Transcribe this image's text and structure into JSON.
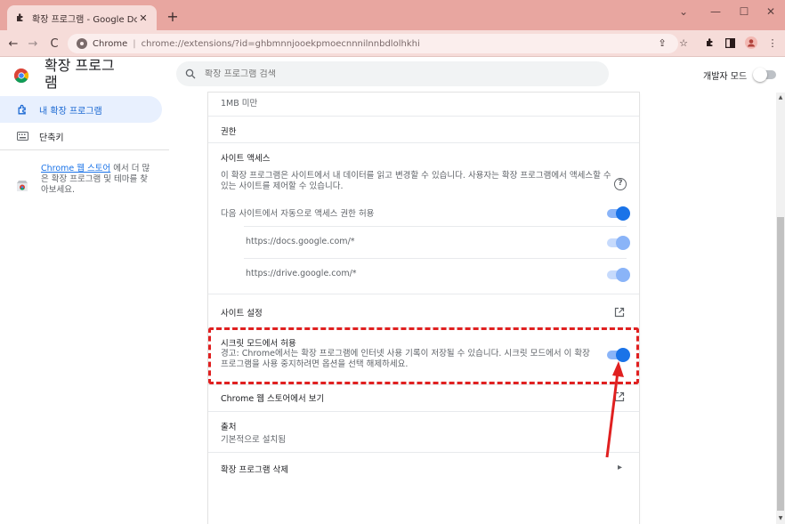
{
  "browser": {
    "tab_title": "확장 프로그램 - Google Docs 오",
    "new_tab_label": "+",
    "omnibox_site": "Chrome",
    "omnibox_url": "chrome://extensions/?id=ghbmnnjooekpmoecnnnilnnbdlolhkhi"
  },
  "header": {
    "title": "확장 프로그램",
    "search_placeholder": "확장 프로그램 검색",
    "dev_mode_label": "개발자 모드"
  },
  "sidebar": {
    "items": [
      {
        "label": "내 확장 프로그램",
        "icon": "puzzle-icon",
        "active": true
      },
      {
        "label": "단축키",
        "icon": "keyboard-icon",
        "active": false
      }
    ],
    "promo_link": "Chrome 웹 스토어",
    "promo_text": "에서 더 많은 확장 프로그램 및 테마를 찾아보세요."
  },
  "details": {
    "size": "1MB 미만",
    "permissions": "권한",
    "site_access_title": "사이트 액세스",
    "site_access_desc": "이 확장 프로그램은 사이트에서 내 데이터를 읽고 변경할 수 있습니다. 사용자는 확장 프로그램에서 액세스할 수 있는 사이트를 제어할 수 있습니다.",
    "auto_access_label": "다음 사이트에서 자동으로 액세스 권한 허용",
    "sites": [
      "https://docs.google.com/*",
      "https://drive.google.com/*"
    ],
    "site_settings": "사이트 설정",
    "incognito_title": "시크릿 모드에서 허용",
    "incognito_warning": "경고: Chrome에서는 확장 프로그램에 인터넷 사용 기록이 저장될 수 있습니다. 시크릿 모드에서 이 확장 프로그램을 사용 중지하려면 옵션을 선택 해제하세요.",
    "webstore_view": "Chrome 웹 스토어에서 보기",
    "source_title": "출처",
    "source_value": "기본적으로 설치됨",
    "remove_label": "확장 프로그램 삭제"
  },
  "colors": {
    "accent": "#1a73e8",
    "annotation": "#e02020",
    "titlebar": "#e8a6a0"
  }
}
